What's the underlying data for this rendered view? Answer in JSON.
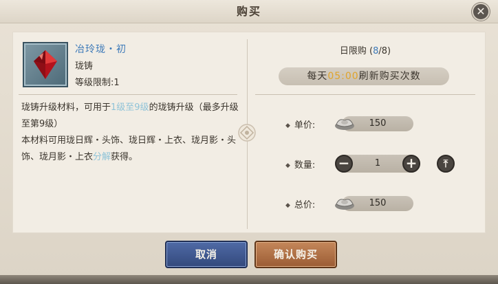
{
  "dialog": {
    "title": "购买",
    "close_icon": "close-icon"
  },
  "item": {
    "name": "冶玲珑・初",
    "type": "珑铸",
    "level_limit": "等级限制:1",
    "icon": "red-crystal-icon",
    "desc_1": "珑铸升级材料，可用于",
    "desc_highlight_1": "1级至9级",
    "desc_2": "的珑铸升级（最多升级至第9级）",
    "desc_3": "本材料可用珑日辉・头饰、珑日辉・上衣、珑月影・头饰、珑月影・上衣",
    "desc_highlight_2": "分解",
    "desc_4": "获得。"
  },
  "purchase": {
    "daily_limit_label": "日限购 (",
    "daily_limit_current": "8",
    "daily_limit_sep": "/",
    "daily_limit_max": "8",
    "daily_limit_close": ")",
    "refresh_prefix": "每天",
    "refresh_time": "05:00",
    "refresh_suffix": "刷新购买次数",
    "unit_price_label": "单价:",
    "unit_price": "150",
    "quantity_label": "数量:",
    "quantity": "1",
    "total_price_label": "总价:",
    "total_price": "150",
    "currency_icon": "silver-ingot-icon"
  },
  "buttons": {
    "cancel": "取消",
    "confirm": "确认购买"
  },
  "colors": {
    "highlight_blue": "#3c79b8",
    "highlight_cyan": "#8fc3d8",
    "time_gold": "#e0a42a"
  }
}
